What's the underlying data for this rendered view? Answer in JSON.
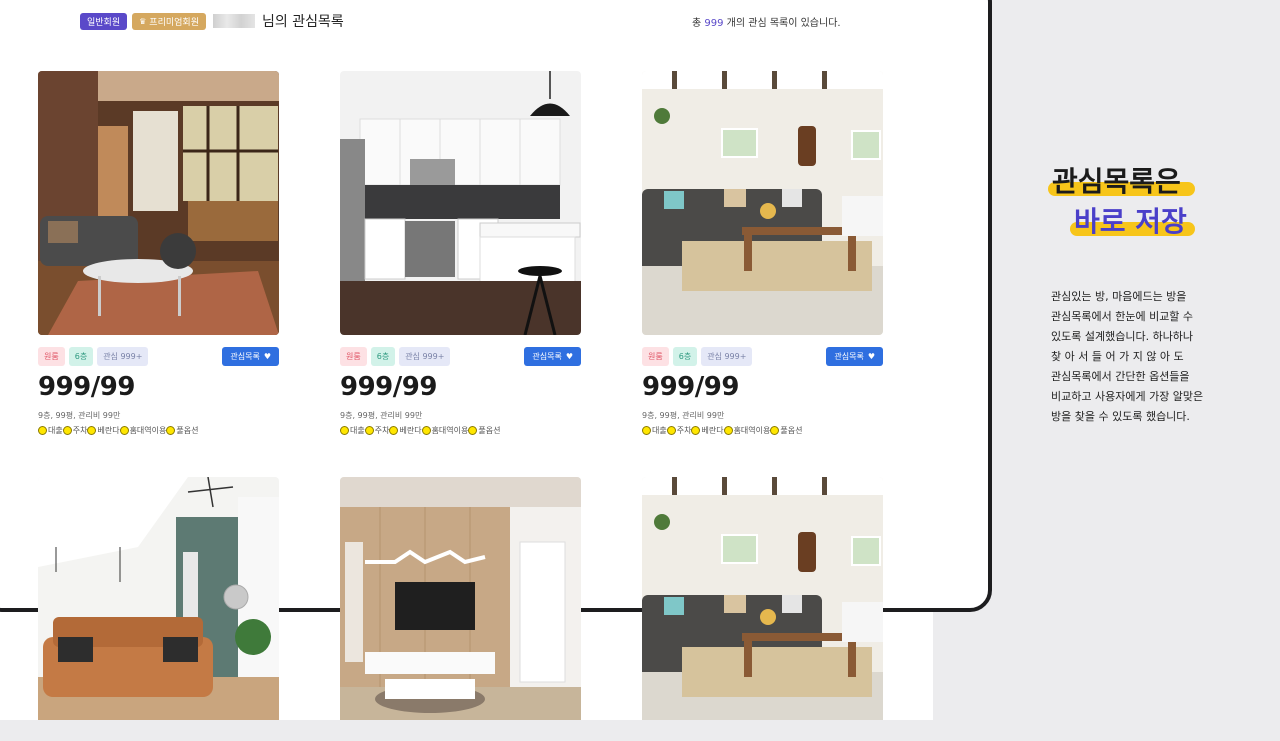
{
  "header": {
    "badge_general": "일반회원",
    "badge_premium": "프리미엄회원",
    "title_suffix": "님의 관심목록",
    "count_prefix": "총",
    "count": "999",
    "count_suffix": "개의 관심 목록이 있습니다."
  },
  "listings": [
    {
      "type_tag": "원룸",
      "floor_tag": "6층",
      "interest_tag": "관심 999+",
      "wishlist_label": "관심목록",
      "price": "999/99",
      "info": "9층, 99평, 관리비 99만",
      "options": [
        "대출",
        "주차",
        "베란다",
        "홈대역이용",
        "풀옵션"
      ],
      "photo": "living-room-wood-sunlight"
    },
    {
      "type_tag": "원룸",
      "floor_tag": "6층",
      "interest_tag": "관심 999+",
      "wishlist_label": "관심목록",
      "price": "999/99",
      "info": "9층, 99평, 관리비 99만",
      "options": [
        "대출",
        "주차",
        "베란다",
        "홈대역이용",
        "풀옵션"
      ],
      "photo": "modern-white-kitchen"
    },
    {
      "type_tag": "원룸",
      "floor_tag": "6층",
      "interest_tag": "관심 999+",
      "wishlist_label": "관심목록",
      "price": "999/99",
      "info": "9층, 99평, 관리비 99만",
      "options": [
        "대출",
        "주차",
        "베란다",
        "홈대역이용",
        "풀옵션"
      ],
      "photo": "white-brick-living-room"
    },
    {
      "photo": "teal-wall-living-room"
    },
    {
      "photo": "tv-wall-wood-room"
    },
    {
      "photo": "white-brick-living-room"
    }
  ],
  "promo": {
    "line1": "관심목록은",
    "line2": "바로 저장",
    "description": "관심있는 방, 마음에드는 방을\n관심목록에서 한눈에 비교할 수\n있도록 설계했습니다. 하나하나\n찾 아 서   들 어 가 지   않 아 도\n관심목록에서 간단한 옵션들을\n비교하고 사용자에게 가장 알맞은\n방을 찾을 수 있도록 했습니다."
  },
  "colors": {
    "accent": "#5a49c9",
    "premium": "#d5a85f",
    "button": "#2f6fe0",
    "highlight": "#f7c51a"
  }
}
